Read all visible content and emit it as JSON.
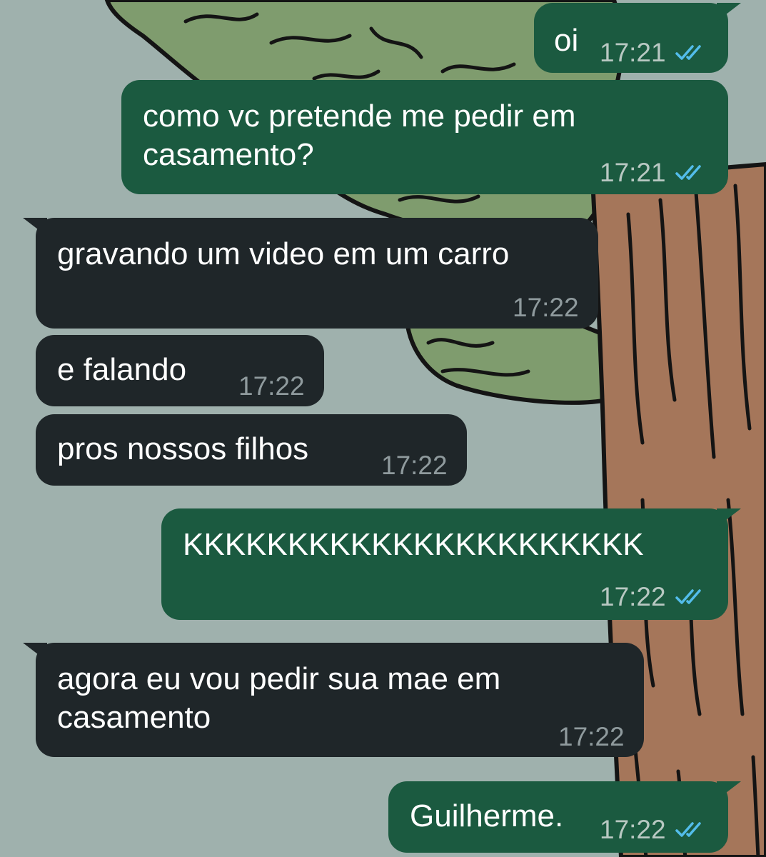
{
  "colors": {
    "outgoing_bubble": "#1b5a40",
    "incoming_bubble": "#1f2629",
    "wallpaper": "#9fb1ad",
    "read_ticks": "#53bdeb"
  },
  "messages": [
    {
      "direction": "out",
      "text": "oi",
      "time": "17:21",
      "status": "read-double-check-icon"
    },
    {
      "direction": "out",
      "text": "como vc pretende me pedir em\ncasamento?",
      "time": "17:21",
      "status": "read-double-check-icon"
    },
    {
      "direction": "in",
      "text": "gravando um video em um carro",
      "time": "17:22"
    },
    {
      "direction": "in",
      "text": "e falando",
      "time": "17:22"
    },
    {
      "direction": "in",
      "text": "pros nossos filhos",
      "time": "17:22"
    },
    {
      "direction": "out",
      "text": "KKKKKKKKKKKKKKKKKKKKKK",
      "time": "17:22",
      "status": "read-double-check-icon"
    },
    {
      "direction": "in",
      "text": "agora eu vou pedir sua mae em\ncasamento",
      "time": "17:22"
    },
    {
      "direction": "out",
      "text": "Guilherme.",
      "time": "17:22",
      "status": "read-double-check-icon"
    }
  ]
}
